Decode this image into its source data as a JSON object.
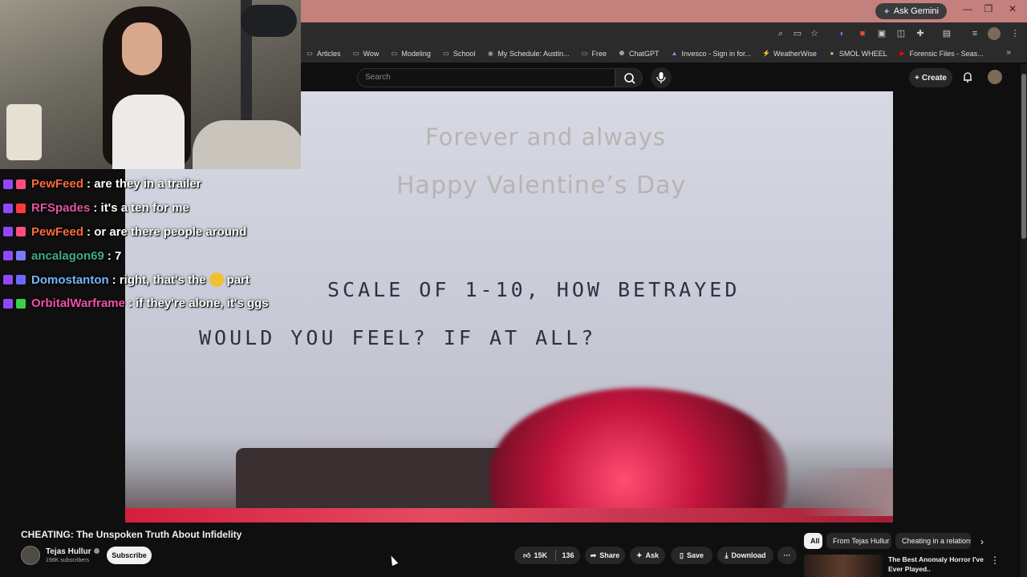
{
  "browser": {
    "ask_gemini": "Ask Gemini",
    "bookmarks": [
      {
        "label": "Articles",
        "icon": "folder-icon"
      },
      {
        "label": "Wow",
        "icon": "folder-icon"
      },
      {
        "label": "Modeling",
        "icon": "folder-icon"
      },
      {
        "label": "School",
        "icon": "folder-icon"
      },
      {
        "label": "My Schedule: Austin...",
        "icon": "globe-icon"
      },
      {
        "label": "Free",
        "icon": "folder-icon"
      },
      {
        "label": "ChatGPT",
        "icon": "chatgpt-icon"
      },
      {
        "label": "Invesco - Sign in for...",
        "icon": "invesco-icon"
      },
      {
        "label": "WeatherWise",
        "icon": "weather-icon"
      },
      {
        "label": "SMOL WHEEL",
        "icon": "wheel-icon"
      },
      {
        "label": "Forensic Files - Seas...",
        "icon": "youtube-icon"
      }
    ],
    "more": "»"
  },
  "youtube": {
    "search_placeholder": "Search",
    "create_label": "Create"
  },
  "video_frame": {
    "line1": "Forever and always",
    "line2": "Happy Valentine’s Day",
    "hand1": "SCALE OF 1-10, HOW BETRAYED",
    "hand2": "WOULD YOU FEEL? IF AT ALL?"
  },
  "chat": [
    {
      "user": "PewFeed",
      "color": "#ff6a3d",
      "msg": ": are they in a trailer"
    },
    {
      "user": "RFSpades",
      "color": "#e0559e",
      "msg": ": it's a ten for me"
    },
    {
      "user": "PewFeed",
      "color": "#ff6a3d",
      "msg": ": or are there people around"
    },
    {
      "user": "ancalagon69",
      "color": "#3faa8a",
      "msg": ": 7"
    },
    {
      "user": "Domostanton",
      "color": "#7ab4ff",
      "msg_pre": ": right, that's the",
      "msg_post": "part"
    },
    {
      "user": "OrbitalWarframe",
      "color": "#f04fa7",
      "msg": ": if they're alone, it's ggs"
    }
  ],
  "video": {
    "title": "CHEATING: The Unspoken Truth About Infidelity",
    "channel": "Tejas Hullur",
    "subscribers": "198K subscribers",
    "subscribe": "Subscribe",
    "likes": "15K",
    "dislikes": "136",
    "share": "Share",
    "ask": "Ask",
    "save": "Save",
    "download": "Download",
    "more": "···"
  },
  "chips": [
    "All",
    "From Tejas Hullur",
    "Cheating in a relationsh"
  ],
  "recommended": {
    "title": "The Best Anomaly Horror I've Ever Played..",
    "more": "⋮"
  },
  "colors": {
    "accent": "#ff0000",
    "titlebar": "#c4807d",
    "background": "#0f0f0f"
  }
}
